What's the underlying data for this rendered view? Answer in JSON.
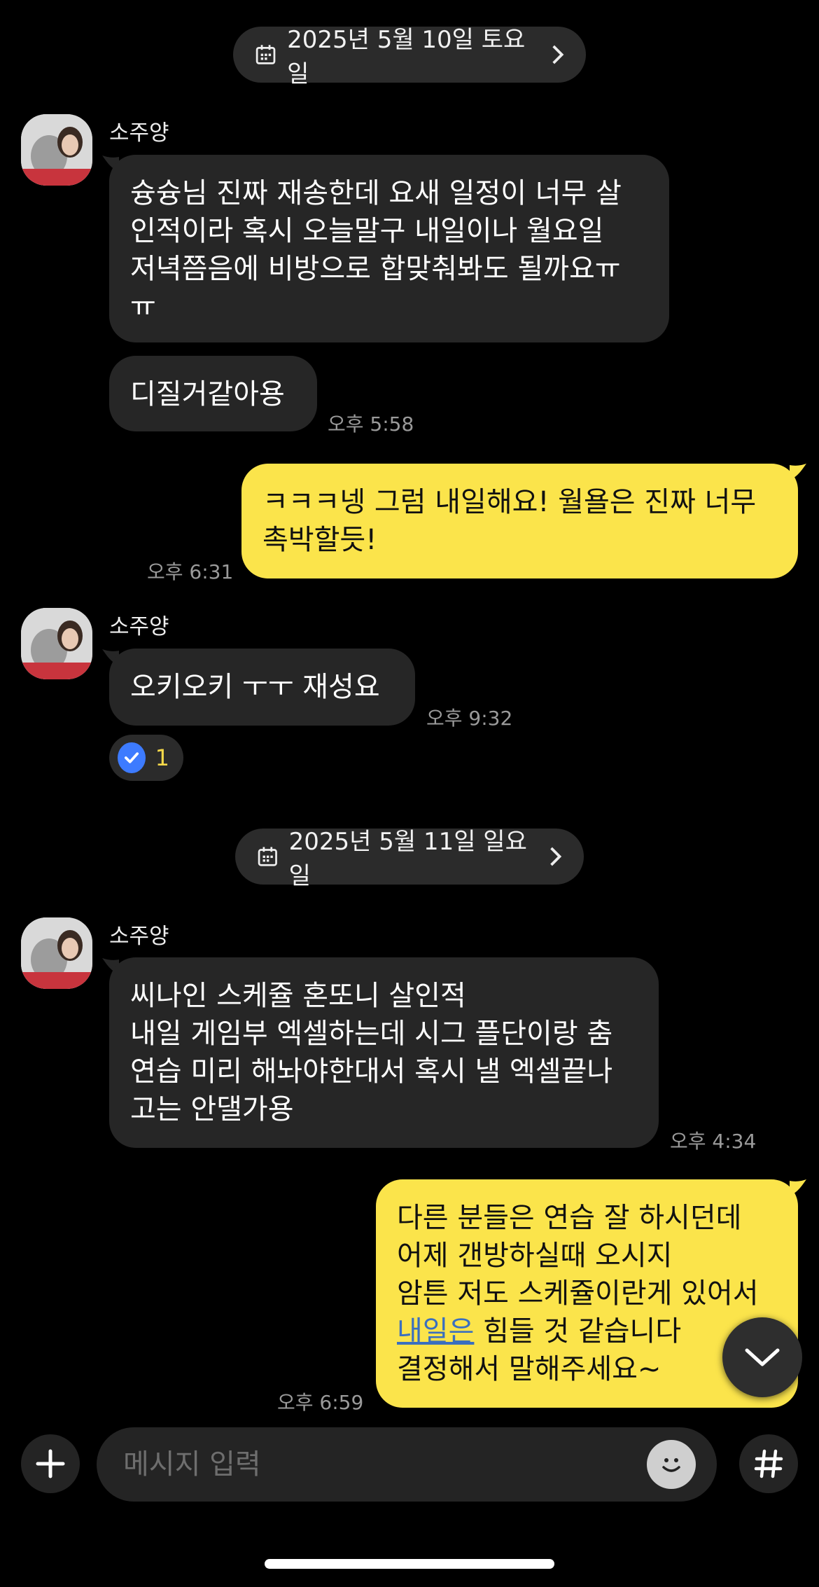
{
  "dates": [
    {
      "label": "2025년 5월 10일 토요일"
    },
    {
      "label": "2025년 5월 11일 일요일"
    }
  ],
  "messages": {
    "m1": {
      "sender": "소주양",
      "text": "슝슝님 진짜 재송한데 요새 일정이 너무 살\n인적이라 혹시 오늘말구 내일이나 월요일\n저녁쯤음에 비방으로 합맞춰봐도 될까요ㅠ\nㅠ"
    },
    "m2": {
      "text": "디질거같아용",
      "time": "오후 5:58"
    },
    "m3": {
      "text": "ㅋㅋㅋ넹 그럼 내일해요! 월욜은 진짜 너무\n촉박할듯!",
      "time": "오후 6:31"
    },
    "m4": {
      "sender": "소주양",
      "text": "오키오키 ㅜㅜ 재성요",
      "time": "오후 9:32",
      "reaction_count": "1"
    },
    "m5": {
      "sender": "소주양",
      "text": "씨나인 스케쥴 혼또니 살인적\n내일 게임부 엑셀하는데 시그 플단이랑 춤\n연습 미리 해놔야한대서 혹시 낼 엑셀끝나\n고는 안댈가용",
      "time": "오후 4:34"
    },
    "m6": {
      "line1": "다른 분들은 연습 잘 하시던데",
      "line2": "어제 갠방하실때 오시지",
      "line3": "암튼 저도 스케쥴이란게 있어서",
      "line4_link": "내일은",
      "line4_rest": " 힘들 것 같습니다",
      "line5": "결정해서 말해주세요~",
      "time": "오후 6:59"
    }
  },
  "composer": {
    "placeholder": "메시지 입력"
  },
  "icons": {
    "calendar": "calendar-icon",
    "chevron_right": "chevron-right-icon",
    "plus": "plus-icon",
    "emoji": "emoji-icon",
    "hash": "hash-icon",
    "scroll_down": "chevron-down-icon",
    "check": "check-icon"
  },
  "colors": {
    "background": "#000000",
    "incoming_bubble": "#262626",
    "outgoing_bubble": "#fbe44b",
    "link": "#3a6fbf",
    "reaction_check": "#3d7bff"
  }
}
